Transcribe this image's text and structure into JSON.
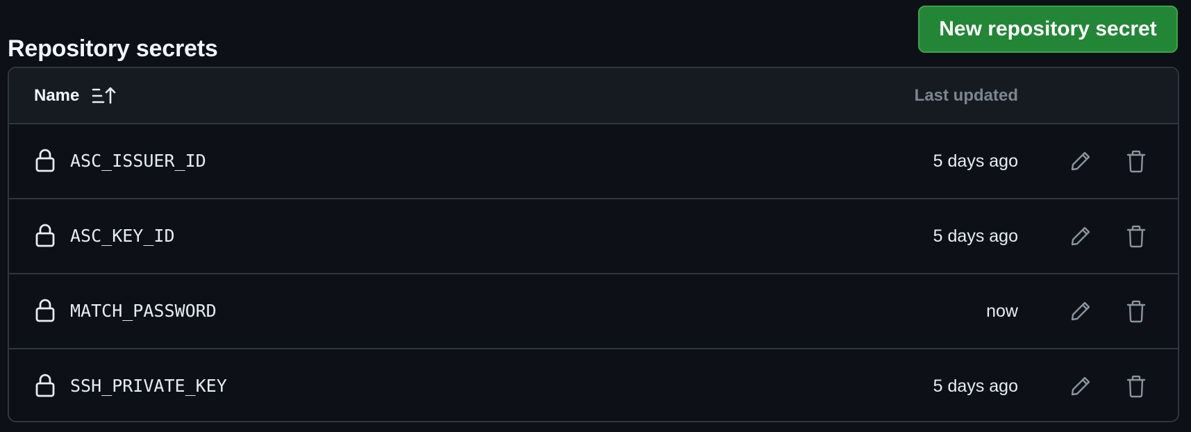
{
  "header": {
    "title": "Repository secrets",
    "new_secret_label": "New repository secret"
  },
  "table": {
    "columns": {
      "name": "Name",
      "last_updated": "Last updated"
    },
    "rows": [
      {
        "name": "ASC_ISSUER_ID",
        "updated": "5 days ago"
      },
      {
        "name": "ASC_KEY_ID",
        "updated": "5 days ago"
      },
      {
        "name": "MATCH_PASSWORD",
        "updated": "now"
      },
      {
        "name": "SSH_PRIVATE_KEY",
        "updated": "5 days ago"
      }
    ]
  },
  "icons": {
    "row_icon": "lock-icon",
    "sort_icon": "sort-ascending-icon",
    "edit_icon": "pencil-icon",
    "delete_icon": "trash-icon"
  },
  "colors": {
    "background": "#0d1117",
    "header_background": "#161b22",
    "border": "#30363d",
    "primary_button": "#238636",
    "muted_text": "#7d8590"
  }
}
